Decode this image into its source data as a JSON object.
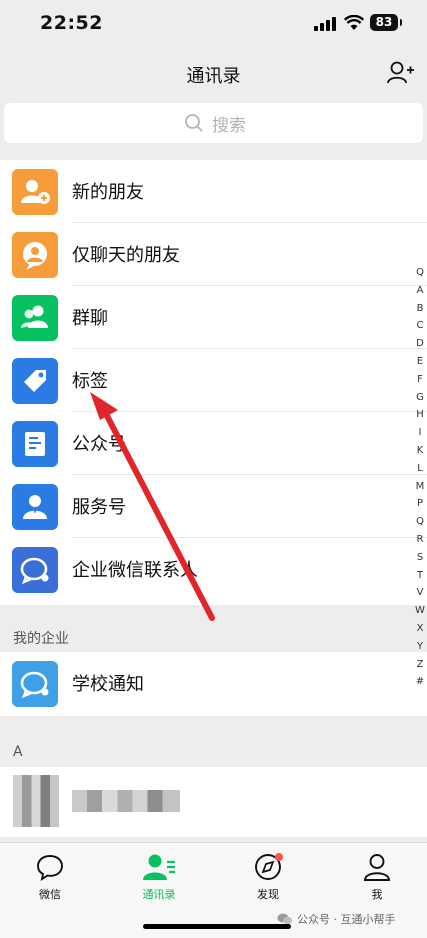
{
  "status_bar": {
    "time": "22:52",
    "battery": "83"
  },
  "nav": {
    "title": "通讯录"
  },
  "search": {
    "label": "搜索"
  },
  "contacts_menu": [
    {
      "label": "新的朋友",
      "icon": "add-friend-icon",
      "color": "#f79c3a"
    },
    {
      "label": "仅聊天的朋友",
      "icon": "chat-only-friend-icon",
      "color": "#f79c3a"
    },
    {
      "label": "群聊",
      "icon": "group-chat-icon",
      "color": "#07c160"
    },
    {
      "label": "标签",
      "icon": "tag-icon",
      "color": "#2b7be5"
    },
    {
      "label": "公众号",
      "icon": "official-account-icon",
      "color": "#2b7be5"
    },
    {
      "label": "服务号",
      "icon": "service-account-icon",
      "color": "#2b7be5"
    },
    {
      "label": "企业微信联系人",
      "icon": "wecom-contact-icon",
      "color": "#3a6fd8"
    }
  ],
  "enterprise": {
    "section_title": "我的企业",
    "items": [
      {
        "label": "学校通知",
        "icon": "school-notice-icon",
        "color": "#3fa0e8"
      }
    ]
  },
  "letter_section": {
    "title": "A"
  },
  "alphabet_index": [
    "Q",
    "A",
    "B",
    "C",
    "D",
    "E",
    "F",
    "G",
    "H",
    "I",
    "K",
    "L",
    "M",
    "P",
    "Q",
    "R",
    "S",
    "T",
    "V",
    "W",
    "X",
    "Y",
    "Z",
    "#"
  ],
  "tabs": [
    {
      "label": "微信",
      "icon": "chat-bubble-icon",
      "active": false
    },
    {
      "label": "通讯录",
      "icon": "contacts-icon",
      "active": true
    },
    {
      "label": "发现",
      "icon": "compass-icon",
      "active": false,
      "badge_dot": true
    },
    {
      "label": "我",
      "icon": "person-icon",
      "active": false
    }
  ],
  "watermark": {
    "text": "公众号 · 互通小帮手"
  },
  "colors": {
    "accent": "#07c160",
    "annotation_arrow": "#e0262b",
    "badge": "#fa5151"
  }
}
